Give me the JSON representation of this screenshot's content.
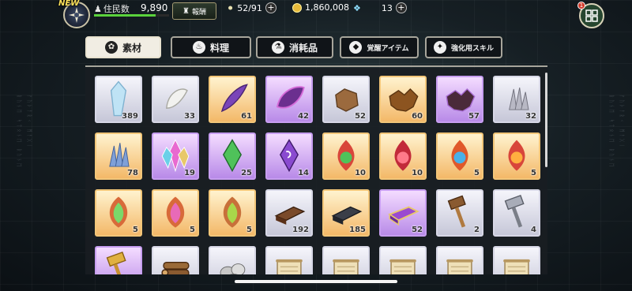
{
  "header": {
    "new_badge": "NEW",
    "population_label": "住民数",
    "population_value": "9,890",
    "population_ratio": 0.82,
    "report_label": "報酬",
    "stamina": "52/91",
    "gold": "1,860,008",
    "gems": "13",
    "menu_notification": "1",
    "plus": "+"
  },
  "tabs": [
    {
      "label": "素材",
      "icon": "leaf-icon",
      "active": true
    },
    {
      "label": "料理",
      "icon": "pot-icon",
      "active": false
    },
    {
      "label": "消耗品",
      "icon": "flask-icon",
      "active": false
    },
    {
      "label": "覚醒アイテム",
      "icon": "gem-icon",
      "active": false
    },
    {
      "label": "強化用スキル",
      "icon": "skill-icon",
      "active": false
    }
  ],
  "items": [
    {
      "name": "blue-crystal",
      "rarity": "silver",
      "count": "389"
    },
    {
      "name": "white-fang",
      "rarity": "silver",
      "count": "33"
    },
    {
      "name": "purple-claw",
      "rarity": "gold",
      "count": "61"
    },
    {
      "name": "dark-wing",
      "rarity": "purple",
      "count": "42"
    },
    {
      "name": "leather-scrap",
      "rarity": "silver",
      "count": "52"
    },
    {
      "name": "beast-hide",
      "rarity": "gold",
      "count": "60"
    },
    {
      "name": "dark-hide",
      "rarity": "purple",
      "count": "57"
    },
    {
      "name": "silver-feathers",
      "rarity": "silver",
      "count": "32"
    },
    {
      "name": "blue-feathers",
      "rarity": "gold",
      "count": "78"
    },
    {
      "name": "rainbow-crystal",
      "rarity": "purple",
      "count": "19"
    },
    {
      "name": "green-gem",
      "rarity": "purple",
      "count": "25"
    },
    {
      "name": "violet-gem",
      "rarity": "purple",
      "count": "14"
    },
    {
      "name": "green-ember",
      "rarity": "gold",
      "count": "10"
    },
    {
      "name": "red-ember",
      "rarity": "gold",
      "count": "10"
    },
    {
      "name": "blue-ember",
      "rarity": "gold",
      "count": "5"
    },
    {
      "name": "orange-ember",
      "rarity": "gold",
      "count": "5"
    },
    {
      "name": "green-flame-stone",
      "rarity": "gold",
      "count": "5"
    },
    {
      "name": "pink-flame-stone",
      "rarity": "gold",
      "count": "5"
    },
    {
      "name": "leaf-flame-stone",
      "rarity": "gold",
      "count": "5"
    },
    {
      "name": "chocolate-bar",
      "rarity": "silver",
      "count": "192"
    },
    {
      "name": "dark-whetstone",
      "rarity": "gold",
      "count": "185"
    },
    {
      "name": "purple-ingot",
      "rarity": "purple",
      "count": "52"
    },
    {
      "name": "wooden-hammer",
      "rarity": "silver",
      "count": "2"
    },
    {
      "name": "steel-hammer",
      "rarity": "silver",
      "count": "4"
    },
    {
      "name": "golden-hammer",
      "rarity": "purple",
      "count": ""
    },
    {
      "name": "logs",
      "rarity": "silver",
      "count": ""
    },
    {
      "name": "stones",
      "rarity": "silver",
      "count": ""
    },
    {
      "name": "scroll-1",
      "rarity": "silver",
      "count": ""
    },
    {
      "name": "scroll-2",
      "rarity": "silver",
      "count": ""
    },
    {
      "name": "scroll-3",
      "rarity": "silver",
      "count": ""
    },
    {
      "name": "scroll-4",
      "rarity": "silver",
      "count": ""
    },
    {
      "name": "scroll-5",
      "rarity": "silver",
      "count": ""
    }
  ],
  "colors": {
    "silver": "#c6c7d8",
    "gold": "#f3b868",
    "purple": "#b88ae8",
    "accent_green": "#5ad23c"
  }
}
